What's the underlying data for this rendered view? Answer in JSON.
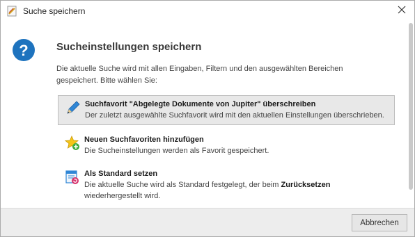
{
  "window": {
    "title": "Suche speichern",
    "app_icon": "document-icon",
    "close_icon": "close-icon"
  },
  "dialog": {
    "icon": "question-icon",
    "heading": "Sucheinstellungen speichern",
    "description": "Die aktuelle Suche wird mit allen Eingaben, Filtern und den ausgewählten Bereichen gespeichert. Bitte wählen Sie:",
    "options": [
      {
        "icon": "pencil-icon",
        "title": "Suchfavorit \"Abgelegte Dokumente von Jupiter\" überschreiben",
        "subtitle": "Der zuletzt ausgewählte Suchfavorit wird mit den aktuellen Einstellungen überschrieben.",
        "selected": true
      },
      {
        "icon": "star-add-icon",
        "title": "Neuen Suchfavoriten hinzufügen",
        "subtitle": "Die Sucheinstellungen werden als Favorit gespeichert.",
        "selected": false
      },
      {
        "icon": "default-setting-icon",
        "title": "Als Standard setzen",
        "subtitle_before": "Die aktuelle Suche wird als Standard festgelegt, der beim ",
        "subtitle_bold": "Zurücksetzen",
        "subtitle_after": " wiederhergestellt wird.",
        "selected": false
      }
    ]
  },
  "footer": {
    "cancel_label": "Abbrechen"
  },
  "colors": {
    "accent_blue": "#1e73be",
    "selected_bg": "#e8e8e8",
    "footer_bg": "#ededed"
  }
}
